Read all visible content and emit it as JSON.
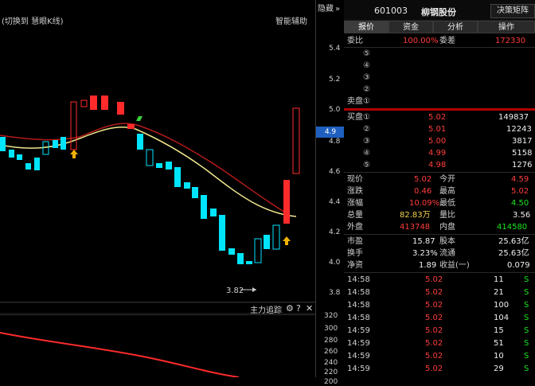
{
  "chart": {
    "top_left": "(切换到 慧眼K线)",
    "top_right": "智能辅助",
    "low_marker": "3.82",
    "bottom_panel_title": "主力追踪",
    "hide_label": "隐藏"
  },
  "axis": {
    "ticks": [
      "5.4",
      "5.2",
      "5.0",
      "4.9",
      "4.8",
      "4.6",
      "4.4",
      "4.2",
      "4.0",
      "3.8",
      "320",
      "300",
      "280",
      "260",
      "240",
      "220",
      "200"
    ],
    "highlight": "4.9"
  },
  "right": {
    "header": {
      "code": "601003",
      "name": "柳钢股份",
      "decision_button": "决策矩阵"
    },
    "tabs": [
      {
        "label": "报价",
        "active": true
      },
      {
        "label": "资金",
        "active": false
      },
      {
        "label": "分析",
        "active": false
      },
      {
        "label": "操作",
        "active": false
      }
    ],
    "committee": {
      "label": "委比",
      "pct": "100.00%",
      "diff_label": "委差",
      "diff": "172330"
    },
    "sell": [
      {
        "idx": "⑤",
        "price": "",
        "vol": ""
      },
      {
        "idx": "④",
        "price": "",
        "vol": ""
      },
      {
        "idx": "③",
        "price": "",
        "vol": ""
      },
      {
        "idx": "②",
        "price": "",
        "vol": ""
      },
      {
        "idx": "①",
        "label": "卖盘",
        "price": "",
        "vol": ""
      }
    ],
    "buy": [
      {
        "idx": "①",
        "label": "买盘",
        "price": "5.02",
        "vol": "149837"
      },
      {
        "idx": "②",
        "price": "5.01",
        "vol": "12243"
      },
      {
        "idx": "③",
        "price": "5.00",
        "vol": "3817"
      },
      {
        "idx": "④",
        "price": "4.99",
        "vol": "5158"
      },
      {
        "idx": "⑤",
        "price": "4.98",
        "vol": "1276"
      }
    ],
    "stats": [
      {
        "a_label": "现价",
        "a_val": "5.02",
        "a_color": "red",
        "b_label": "今开",
        "b_val": "4.59",
        "b_color": "red"
      },
      {
        "a_label": "涨跌",
        "a_val": "0.46",
        "a_color": "red",
        "b_label": "最高",
        "b_val": "5.02",
        "b_color": "red"
      },
      {
        "a_label": "涨幅",
        "a_val": "10.09%",
        "a_color": "red",
        "b_label": "最低",
        "b_val": "4.50",
        "b_color": "green"
      },
      {
        "a_label": "总量",
        "a_val": "82.83万",
        "a_color": "white",
        "b_label": "量比",
        "b_val": "3.56",
        "b_color": "white"
      },
      {
        "a_label": "外盘",
        "a_val": "413748",
        "a_color": "red",
        "b_label": "内盘",
        "b_val": "414580",
        "b_color": "green"
      }
    ],
    "stats2": [
      {
        "a_label": "市盈",
        "a_val": "15.87",
        "b_label": "股本",
        "b_val": "25.63亿"
      },
      {
        "a_label": "换手",
        "a_val": "3.23%",
        "b_label": "流通",
        "b_val": "25.63亿"
      },
      {
        "a_label": "净资",
        "a_val": "1.89",
        "b_label": "收益(一)",
        "b_val": "0.079"
      }
    ],
    "ticks": [
      {
        "time": "14:58",
        "price": "5.02",
        "vol": "11",
        "side": "S"
      },
      {
        "time": "14:58",
        "price": "5.02",
        "vol": "21",
        "side": "S"
      },
      {
        "time": "14:58",
        "price": "5.02",
        "vol": "100",
        "side": "S"
      },
      {
        "time": "14:58",
        "price": "5.02",
        "vol": "104",
        "side": "S"
      },
      {
        "time": "14:59",
        "price": "5.02",
        "vol": "15",
        "side": "S"
      },
      {
        "time": "14:59",
        "price": "5.02",
        "vol": "51",
        "side": "S"
      },
      {
        "time": "14:59",
        "price": "5.02",
        "vol": "10",
        "side": "S"
      },
      {
        "time": "14:59",
        "price": "5.02",
        "vol": "29",
        "side": "S"
      }
    ]
  },
  "colors": {
    "up": "#ff2b2b",
    "down": "#00e5ff",
    "ma1": "#f0e68c",
    "ma2": "#b31b1b",
    "arrow_up": "#f0b000",
    "arrow_down": "#3bd13b"
  }
}
